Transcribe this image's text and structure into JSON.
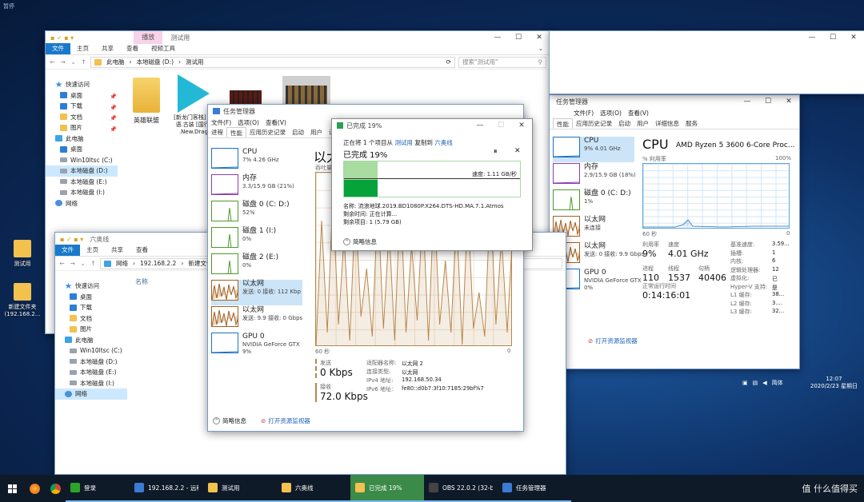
{
  "desktop": {
    "topleft_label": "暂停",
    "icons": [
      {
        "label": "测试用"
      },
      {
        "label": "新建文件夹 (192.168.2..."
      }
    ]
  },
  "explorer1": {
    "ribbon_context_tab": "播放",
    "title": "测试用",
    "ribbon_tabs": [
      "文件",
      "主页",
      "共享",
      "查看",
      "视频工具"
    ],
    "path": [
      "此电脑",
      "本地磁盘 (D:)",
      "测试用"
    ],
    "search_placeholder": "搜索\"测试用\"",
    "nav": [
      {
        "label": "快速访问",
        "icon": "star",
        "level": 0
      },
      {
        "label": "桌面",
        "icon": "blue",
        "level": 1
      },
      {
        "label": "下载",
        "icon": "blue",
        "level": 1
      },
      {
        "label": "文档",
        "icon": "yellow",
        "level": 1
      },
      {
        "label": "图片",
        "icon": "yellow",
        "level": 1
      },
      {
        "label": "此电脑",
        "icon": "pc",
        "level": 0
      },
      {
        "label": "桌面",
        "icon": "blue",
        "level": 1
      },
      {
        "label": "Win10ltsc (C:)",
        "icon": "drive",
        "level": 1
      },
      {
        "label": "本地磁盘 (D:)",
        "icon": "drive",
        "level": 1,
        "selected": true
      },
      {
        "label": "本地磁盘 (E:)",
        "icon": "drive",
        "level": 1
      },
      {
        "label": "本地磁盘 (I:)",
        "icon": "drive",
        "level": 1
      },
      {
        "label": "网络",
        "icon": "net",
        "level": 0
      }
    ],
    "files": [
      {
        "label": "英雄联盟"
      },
      {
        "label": "[新龙门客栈] 国语.古装 [国行]"
      },
      {
        "label": ".New.Drag"
      }
    ]
  },
  "explorer2": {
    "title": "六奥线",
    "path": [
      "网络",
      "192.168.2.2",
      "新建文件夹"
    ],
    "column_name": "名称",
    "nav": [
      {
        "label": "快速访问",
        "icon": "star",
        "level": 0
      },
      {
        "label": "桌面",
        "icon": "blue",
        "level": 1
      },
      {
        "label": "下载",
        "icon": "blue",
        "level": 1
      },
      {
        "label": "文档",
        "icon": "yellow",
        "level": 1
      },
      {
        "label": "图片",
        "icon": "yellow",
        "level": 1
      },
      {
        "label": "此电脑",
        "icon": "pc",
        "level": 0
      },
      {
        "label": "Win10ltsc (C:)",
        "icon": "drive",
        "level": 1
      },
      {
        "label": "本地磁盘 (D:)",
        "icon": "drive",
        "level": 1
      },
      {
        "label": "本地磁盘 (E:)",
        "icon": "drive",
        "level": 1
      },
      {
        "label": "本地磁盘 (I:)",
        "icon": "drive",
        "level": 1
      },
      {
        "label": "网络",
        "icon": "net",
        "level": 0,
        "selected": true
      }
    ]
  },
  "taskmgr_left": {
    "title": "任务管理器",
    "tabs": [
      "进程",
      "性能",
      "应用历史记录",
      "启动",
      "用户",
      "详细信息"
    ],
    "items": [
      {
        "name": "CPU",
        "sub": "7% 4.26 GHz",
        "color": "#1a73c7"
      },
      {
        "name": "内存",
        "sub": "3.3/15.9 GB (21%)",
        "color": "#8b3fb0"
      },
      {
        "name": "磁盘 0 (C: D:)",
        "sub": "52%",
        "color": "#4c9a2a"
      },
      {
        "name": "磁盘 1 (I:)",
        "sub": "0%",
        "color": "#4c9a2a"
      },
      {
        "name": "磁盘 2 (E:)",
        "sub": "0%",
        "color": "#4c9a2a"
      },
      {
        "name": "以太网",
        "sub": "发送: 0 接收: 112 Kbp",
        "color": "#a5601e",
        "selected": true
      },
      {
        "name": "以太网",
        "sub": "发送: 9.9 接收: 0 Gbps",
        "color": "#a5601e"
      },
      {
        "name": "GPU 0",
        "sub": "NVIDIA GeForce GTX",
        "sub2": "9%",
        "color": "#1a73c7"
      }
    ],
    "heading": "以太",
    "graph_label": "吞吐量",
    "axis_left": "60 秒",
    "axis_right": "0",
    "send_label": "发送",
    "send_value": "0 Kbps",
    "recv_label": "接收",
    "recv_value": "72.0 Kbps",
    "details": [
      {
        "k": "适配器名称:",
        "v": "以太网 2"
      },
      {
        "k": "连接类型:",
        "v": "以太网"
      },
      {
        "k": "IPv4 地址:",
        "v": "192.168.50.34"
      },
      {
        "k": "IPv6 地址:",
        "v": "fe80::d0b7:3f10:7185:29bf%7"
      }
    ],
    "brief": "简略信息",
    "monitor": "打开资源监视器"
  },
  "copy_dialog": {
    "title": "已完成 19%",
    "line1_prefix": "正在将 1 个项目从",
    "line1_src": "测试用",
    "line1_mid": "复制到",
    "line1_dst": "六奥线",
    "heading": "已完成 19%",
    "progress": 19,
    "speed": "速度: 1.11 GB/秒",
    "name": "名称: 流浪地球.2019.BD1080P.X264.DTS-HD.MA.7.1.Atmos",
    "remain_time": "剩余时间: 正在计算...",
    "remain_items": "剩余项目: 1 (5.79 GB)",
    "brief": "简略信息"
  },
  "taskmgr_right": {
    "title": "任务管理器",
    "menu": [
      "文件(F)",
      "选项(O)",
      "查看(V)"
    ],
    "tabs": [
      "性能",
      "应用历史记录",
      "启动",
      "用户",
      "详细信息",
      "服务"
    ],
    "items": [
      {
        "name": "CPU",
        "sub": "9% 4.01 GHz",
        "color": "#1a73c7",
        "selected": true
      },
      {
        "name": "内存",
        "sub": "2.9/15.9 GB (18%)",
        "color": "#8b3fb0"
      },
      {
        "name": "磁盘 0 (C: D:)",
        "sub": "1%",
        "color": "#4c9a2a"
      },
      {
        "name": "以太网",
        "sub": "未连接",
        "color": "#a5601e"
      },
      {
        "name": "以太网",
        "sub": "发送: 0 接收: 9.9 Gbps",
        "color": "#a5601e"
      },
      {
        "name": "GPU 0",
        "sub": "NVIDIA GeForce GTX",
        "sub2": "0%",
        "color": "#1a73c7"
      }
    ],
    "heading": "CPU",
    "cpu_model": "AMD Ryzen 5 3600 6-Core Proc...",
    "graph_label": "% 利用率",
    "graph_max": "100%",
    "axis_left": "60 秒",
    "axis_right": "0",
    "stats": [
      {
        "k": "利用率",
        "v": "9%"
      },
      {
        "k": "速度",
        "v": "4.01 GHz"
      },
      {
        "k": "进程",
        "v": "110"
      },
      {
        "k": "线程",
        "v": "1537"
      },
      {
        "k": "句柄",
        "v": "40406"
      },
      {
        "k": "正常运行时间",
        "v": "0:14:16:01"
      }
    ],
    "specs": [
      {
        "k": "基准速度:",
        "v": "3.59..."
      },
      {
        "k": "插槽:",
        "v": "1"
      },
      {
        "k": "内核:",
        "v": "6"
      },
      {
        "k": "逻辑处理器:",
        "v": "12"
      },
      {
        "k": "虚拟化:",
        "v": "已"
      },
      {
        "k": "Hyper-V 支持:",
        "v": "是"
      },
      {
        "k": "L1 缓存:",
        "v": "38..."
      },
      {
        "k": "L2 缓存:",
        "v": "3...."
      },
      {
        "k": "L3 缓存:",
        "v": "32..."
      }
    ],
    "monitor": "打开资源监视器"
  },
  "taskbar": {
    "items": [
      {
        "label": "登录",
        "icon": "#2aa52a"
      },
      {
        "label": "192.168.2.2 - 远程...",
        "icon": "#3a7bd5"
      },
      {
        "label": "测试用",
        "icon": "#f2c14e"
      },
      {
        "label": "六奥线",
        "icon": "#f2c14e"
      },
      {
        "label": "已完成 19%",
        "icon": "#f2c14e",
        "active": true
      },
      {
        "label": "OBS 22.0.2 (32-bi...",
        "icon": "#444444"
      },
      {
        "label": "任务管理器",
        "icon": "#3a7bd5"
      }
    ],
    "tray_lang": "简体",
    "time": "12:07",
    "date": "2020/2/23 星期日"
  },
  "watermark": "值 什么值得买"
}
